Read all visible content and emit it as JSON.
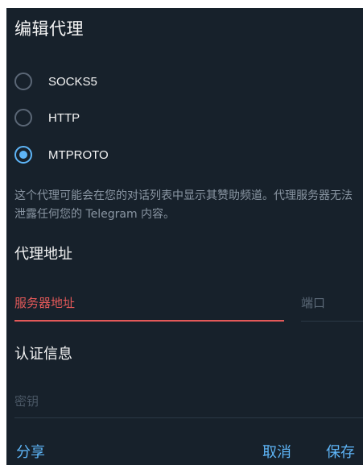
{
  "dialog": {
    "title": "编辑代理",
    "proxy_types": [
      {
        "label": "SOCKS5",
        "selected": false
      },
      {
        "label": "HTTP",
        "selected": false
      },
      {
        "label": "MTPROTO",
        "selected": true
      }
    ],
    "description": "这个代理可能会在您的对话列表中显示其赞助频道。代理服务器无法泄露任何您的 Telegram 内容。",
    "address_section": {
      "title": "代理地址",
      "server_placeholder": "服务器地址",
      "port_placeholder": "端口"
    },
    "auth_section": {
      "title": "认证信息",
      "secret_placeholder": "密钥"
    },
    "buttons": {
      "share": "分享",
      "cancel": "取消",
      "save": "保存"
    }
  },
  "colors": {
    "background": "#17212b",
    "accent": "#5eb5f7",
    "error": "#e35959",
    "text": "#f5f5f5",
    "muted": "#8a96a3"
  },
  "icons": {
    "radio_off": "radio-unchecked-icon",
    "radio_on": "radio-checked-icon"
  }
}
